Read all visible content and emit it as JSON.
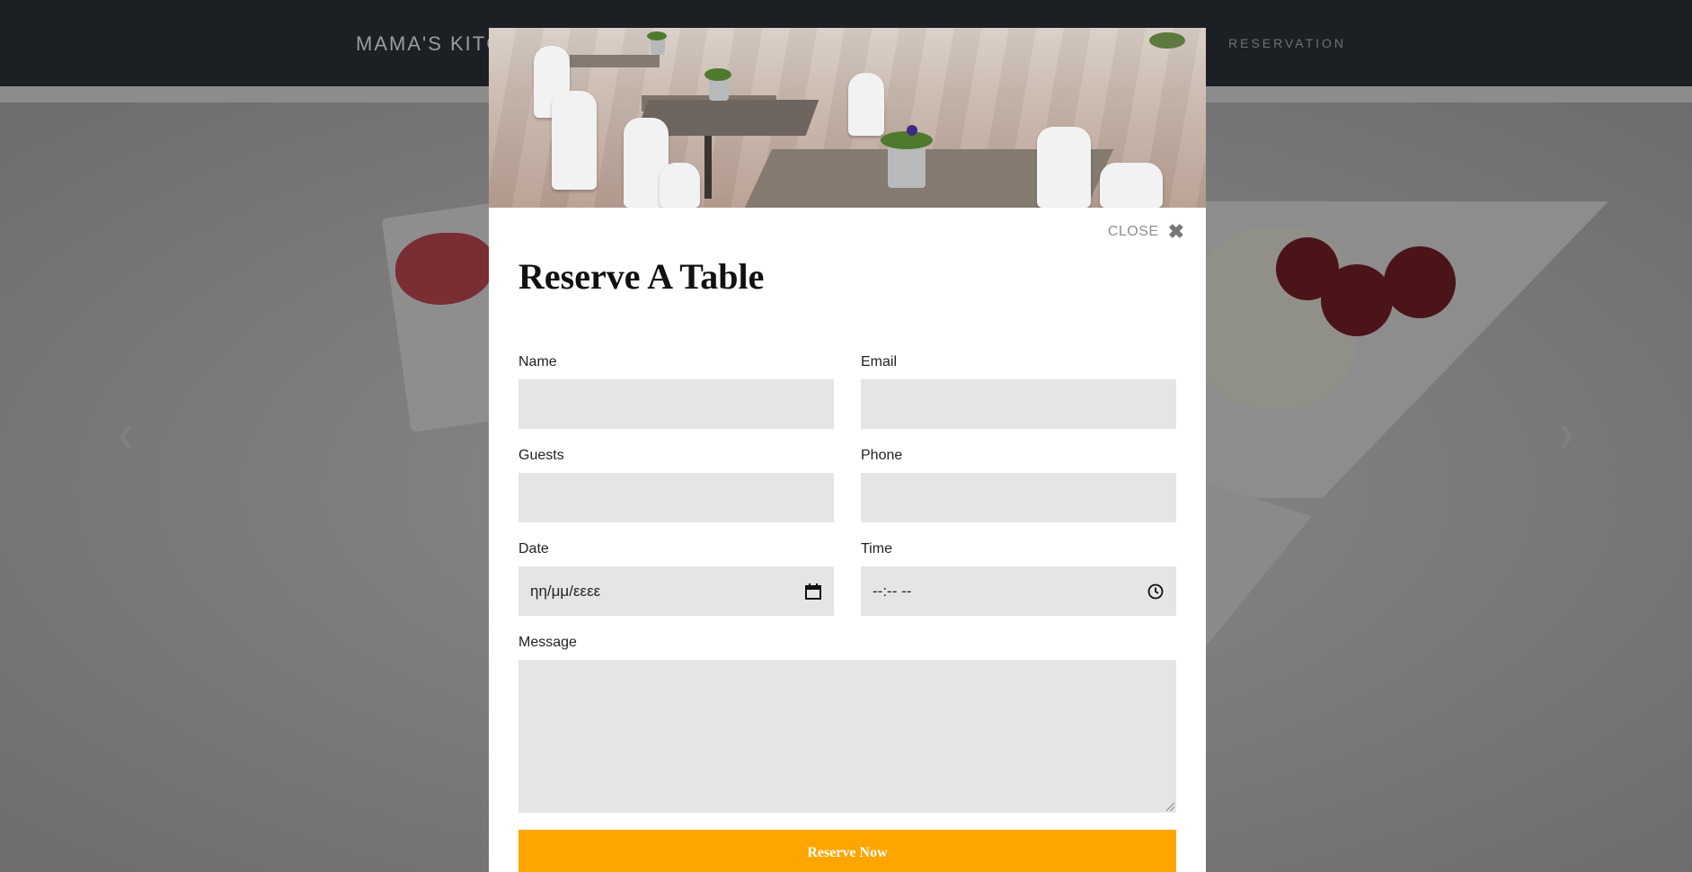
{
  "navbar": {
    "brand": "MAMA'S KITC",
    "links": [
      "RESERVATION"
    ]
  },
  "carousel": {
    "prev_icon": "chevron-left-icon",
    "next_icon": "chevron-right-icon"
  },
  "modal": {
    "close_label": "CLOSE",
    "close_icon": "close-x-icon",
    "title": "Reserve A Table",
    "fields": {
      "name": {
        "label": "Name",
        "value": ""
      },
      "email": {
        "label": "Email",
        "value": ""
      },
      "guests": {
        "label": "Guests",
        "value": ""
      },
      "phone": {
        "label": "Phone",
        "value": ""
      },
      "date": {
        "label": "Date",
        "placeholder": "ηη/μμ/εεεε",
        "icon": "calendar-icon"
      },
      "time": {
        "label": "Time",
        "placeholder": "--:-- --",
        "icon": "clock-icon"
      },
      "message": {
        "label": "Message",
        "value": ""
      }
    },
    "submit_label": "Reserve Now"
  },
  "colors": {
    "accent": "#ffa500",
    "input_bg": "#e5e5e5",
    "navbar_bg": "#1c2024"
  }
}
